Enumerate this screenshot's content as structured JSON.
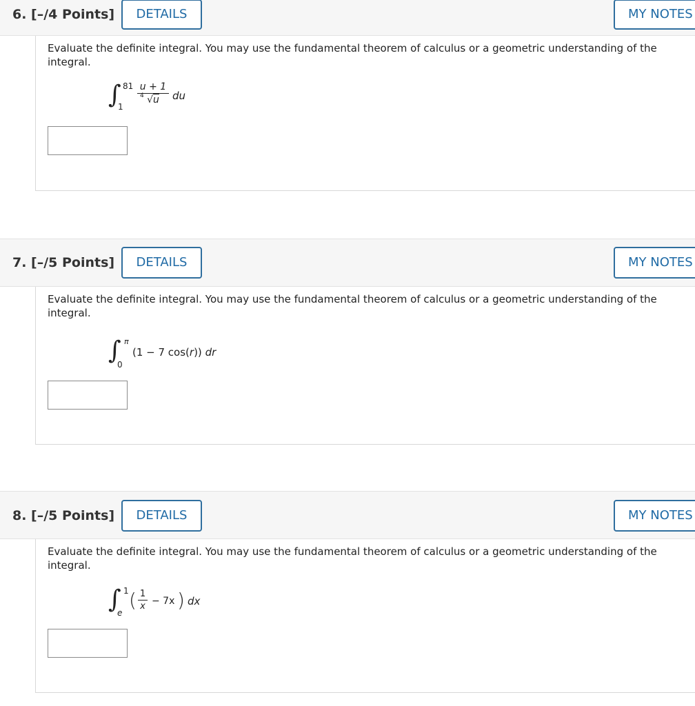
{
  "questions": [
    {
      "title": "6. [–/4 Points]",
      "details_label": "DETAILS",
      "notes_label": "MY NOTES",
      "prompt": "Evaluate the definite integral. You may use the fundamental theorem of calculus or a geometric understanding of the integral.",
      "integral": {
        "upper": "81",
        "lower": "1",
        "numerator": "u + 1",
        "root_index": "4",
        "radicand": "u",
        "differential": "du"
      }
    },
    {
      "title": "7. [–/5 Points]",
      "details_label": "DETAILS",
      "notes_label": "MY NOTES",
      "prompt": "Evaluate the definite integral. You may use the fundamental theorem of calculus or a geometric understanding of the integral.",
      "integral": {
        "upper": "π",
        "lower": "0",
        "integrand_open": "(1 − 7 cos(",
        "integrand_var": "r",
        "integrand_close": "))",
        "differential": "dr"
      }
    },
    {
      "title": "8. [–/5 Points]",
      "details_label": "DETAILS",
      "notes_label": "MY NOTES",
      "prompt": "Evaluate the definite integral. You may use the fundamental theorem of calculus or a geometric understanding of the integral.",
      "integral": {
        "upper": "1",
        "lower": "e",
        "frac_num": "1",
        "frac_den": "x",
        "rest": "− 7x",
        "differential": "dx"
      }
    }
  ]
}
